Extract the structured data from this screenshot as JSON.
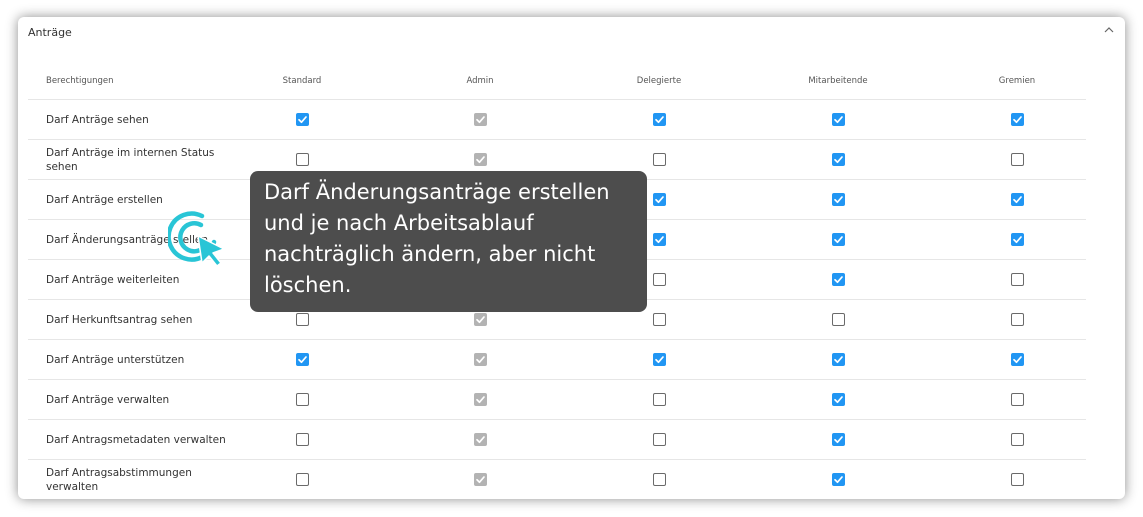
{
  "panel": {
    "title": "Anträge"
  },
  "table": {
    "headers": [
      "Berechtigungen",
      "Standard",
      "Admin",
      "Delegierte",
      "Mitarbeitende",
      "Gremien"
    ],
    "rows": [
      {
        "label": "Darf Anträge sehen",
        "states": [
          "on",
          "dis",
          "on",
          "on",
          "on"
        ]
      },
      {
        "label": "Darf Anträge im internen Status sehen",
        "states": [
          "off",
          "dis",
          "off",
          "on",
          "off"
        ]
      },
      {
        "label": "Darf Anträge erstellen",
        "states": [
          "on",
          "dis",
          "on",
          "on",
          "on"
        ]
      },
      {
        "label": "Darf Änderungsanträge stellen",
        "states": [
          "on",
          "dis",
          "on",
          "on",
          "on"
        ]
      },
      {
        "label": "Darf Anträge weiterleiten",
        "states": [
          "off",
          "dis",
          "off",
          "on",
          "off"
        ]
      },
      {
        "label": "Darf Herkunftsantrag sehen",
        "states": [
          "off",
          "dis",
          "off",
          "off",
          "off"
        ]
      },
      {
        "label": "Darf Anträge unterstützen",
        "states": [
          "on",
          "dis",
          "on",
          "on",
          "on"
        ]
      },
      {
        "label": "Darf Anträge verwalten",
        "states": [
          "off",
          "dis",
          "off",
          "on",
          "off"
        ]
      },
      {
        "label": "Darf Antragsmetadaten verwalten",
        "states": [
          "off",
          "dis",
          "off",
          "on",
          "off"
        ]
      },
      {
        "label": "Darf Antragsabstimmungen verwalten",
        "states": [
          "off",
          "dis",
          "off",
          "on",
          "off"
        ]
      }
    ]
  },
  "tooltip": {
    "text": "Darf Änderungsanträge erstellen und je nach Arbeitsablauf nachträglich ändern, aber nicht löschen."
  },
  "icons": {
    "collapse": "chevron-up-icon",
    "pointer": "click-pointer-icon"
  },
  "colors": {
    "checked": "#2196f3",
    "disabled": "#b3b3b3",
    "tooltip_bg": "#4d4d4d",
    "pointer": "#29c5d6"
  }
}
